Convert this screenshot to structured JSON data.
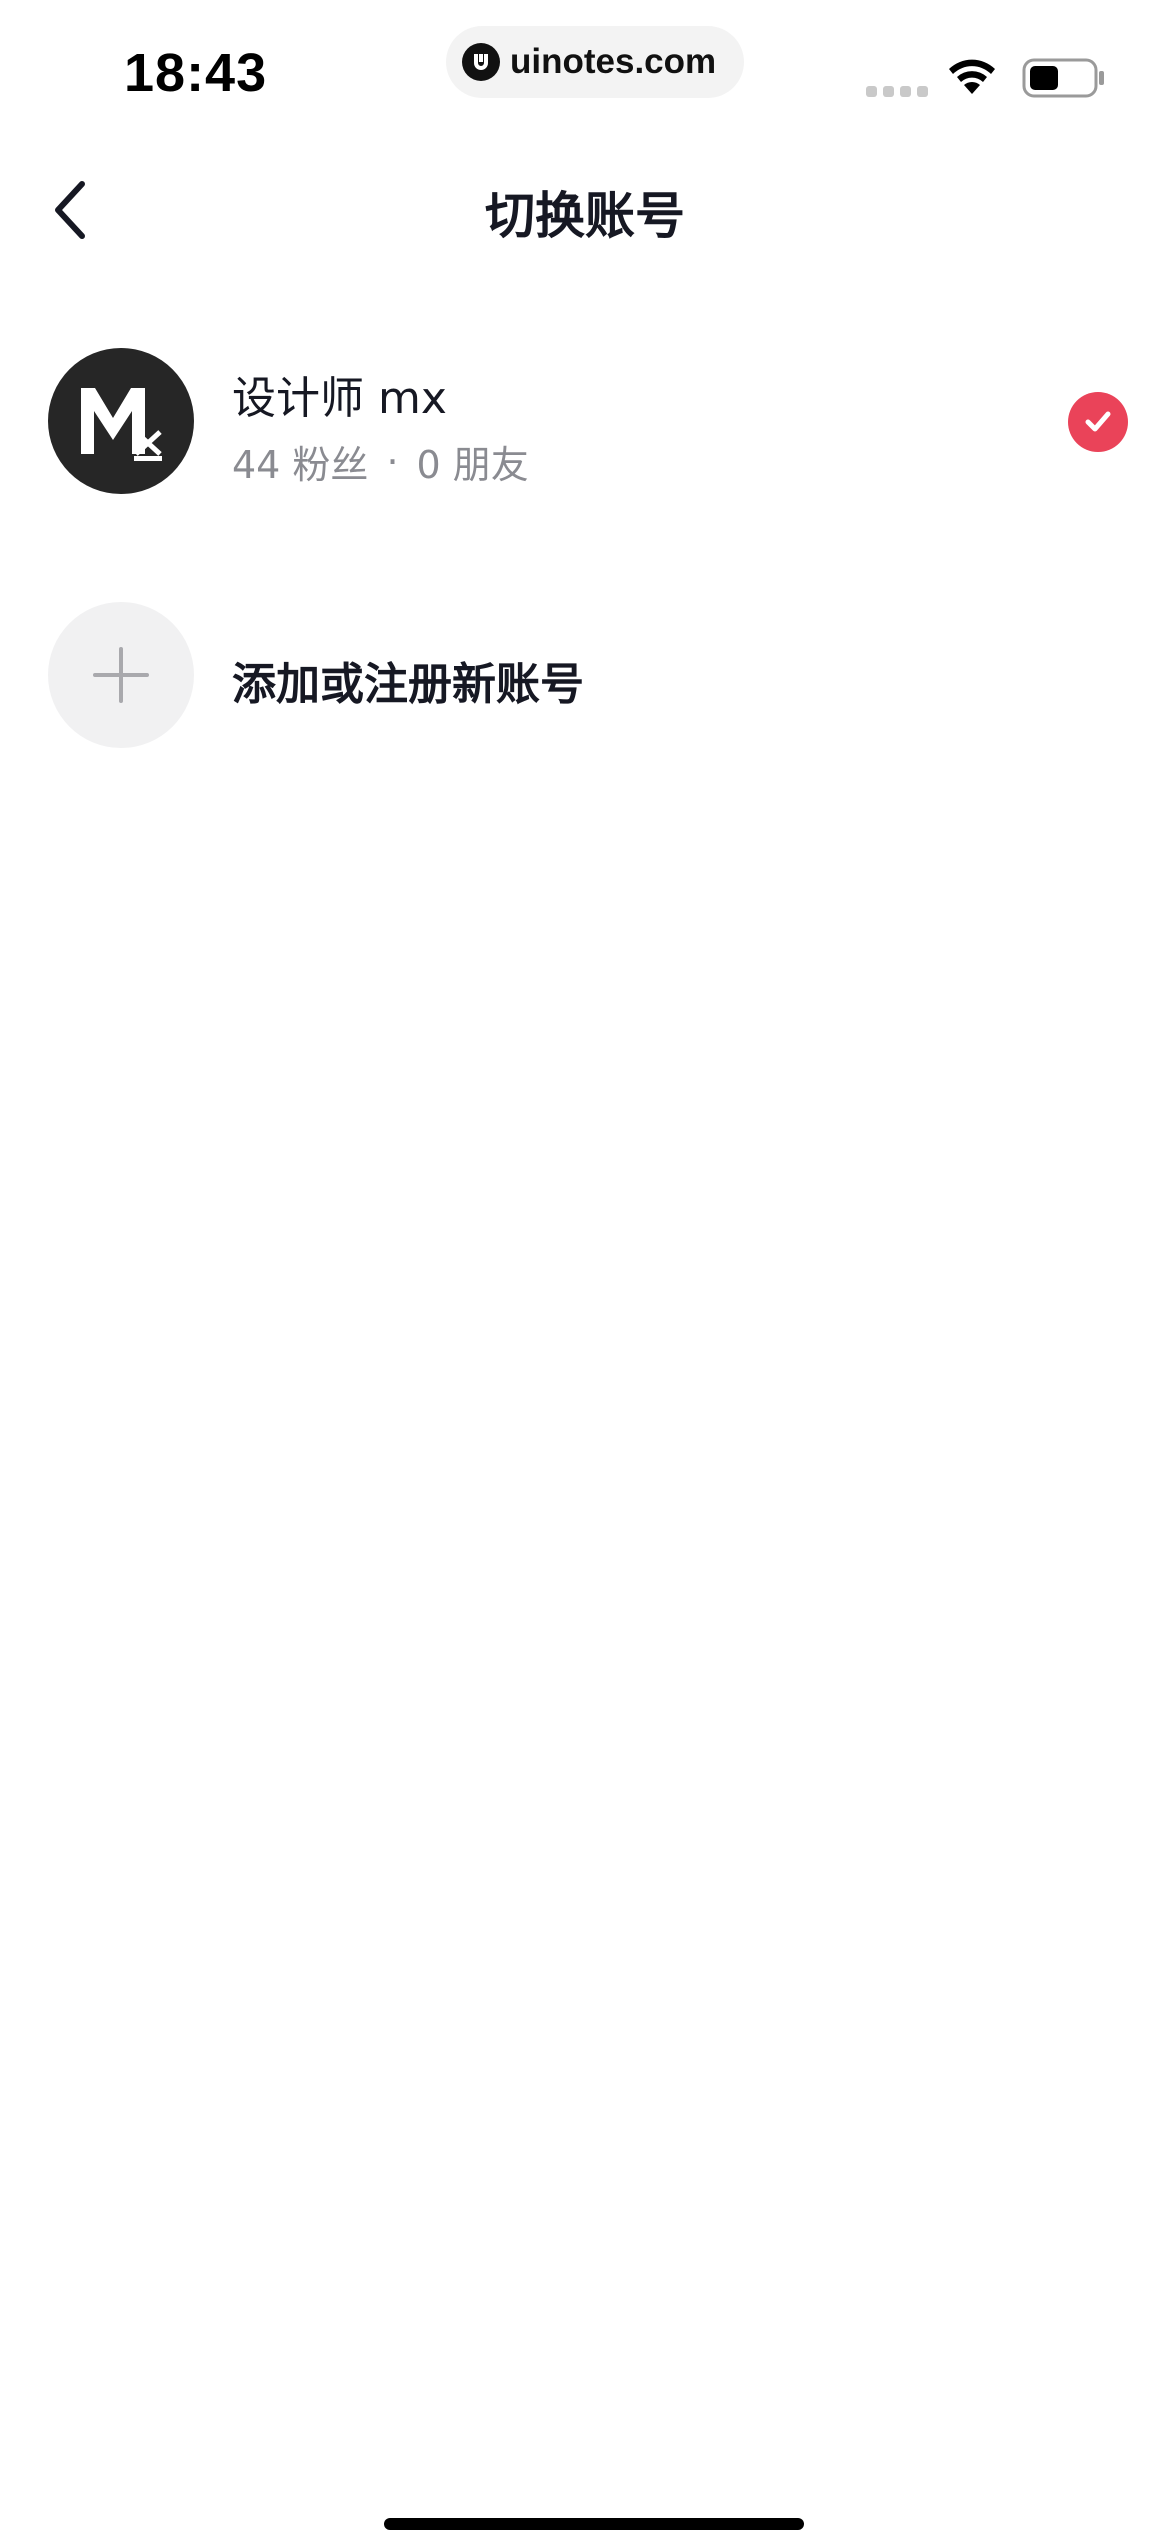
{
  "status_bar": {
    "time": "18:43",
    "url": "uinotes.com",
    "icons": [
      "signal-icon",
      "wifi-icon",
      "battery-icon"
    ]
  },
  "nav": {
    "back_icon": "chevron-left-icon",
    "title": "切换账号"
  },
  "current_account": {
    "name": "设计师 mx",
    "followers": "44 粉丝",
    "separator": "·",
    "friends": "0 朋友",
    "selected": true,
    "check_color": "#ea4359"
  },
  "add_account": {
    "icon": "plus-icon",
    "label": "添加或注册新账号"
  },
  "colors": {
    "text_primary": "#161823",
    "text_secondary": "#8a8b91",
    "accent": "#ea4359"
  }
}
